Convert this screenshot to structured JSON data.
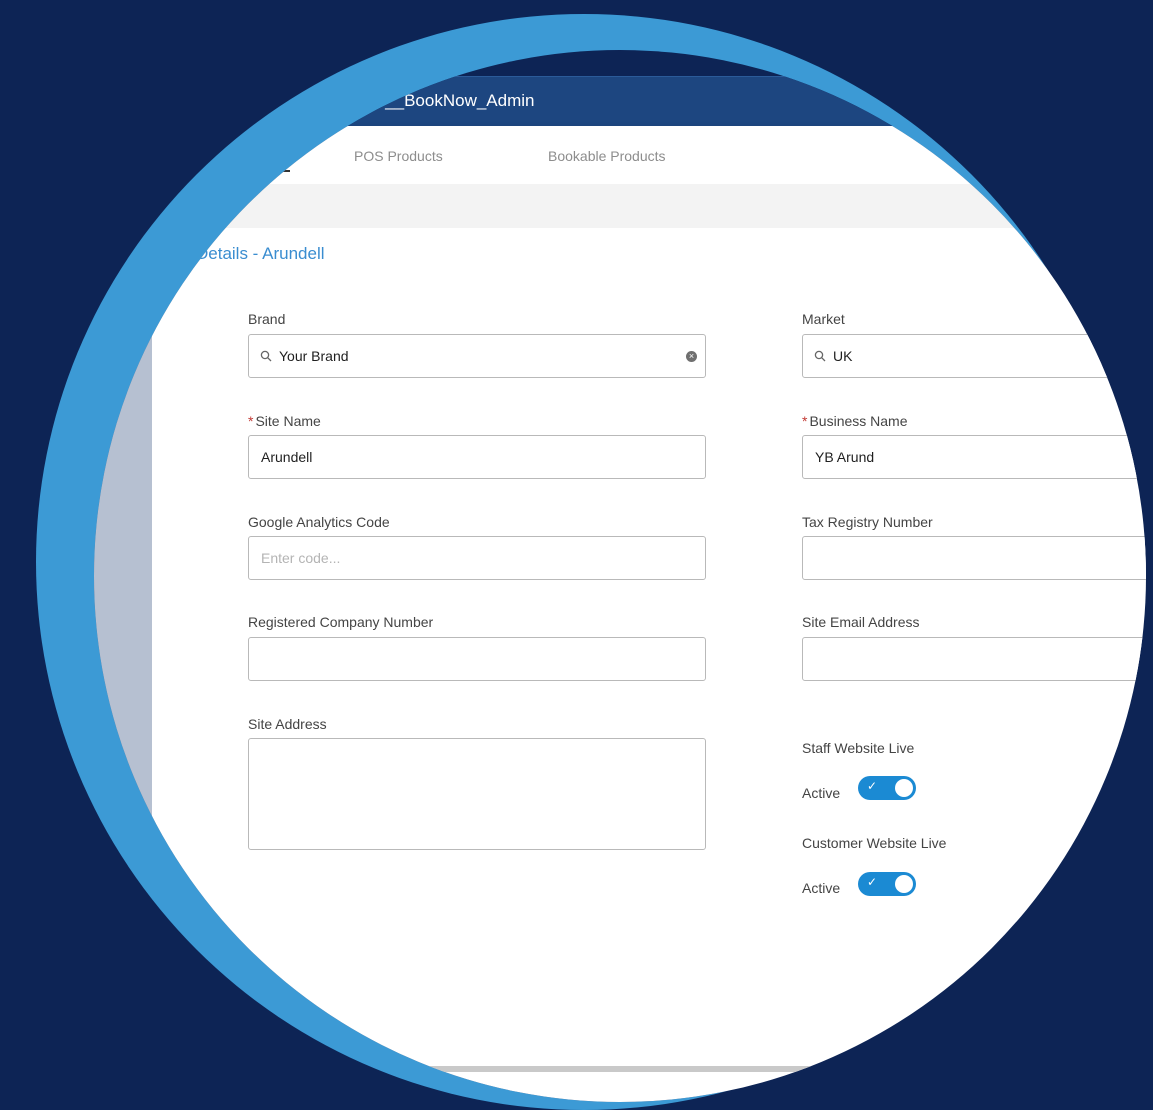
{
  "app": {
    "title": "now__BookNow_Admin"
  },
  "tabs": [
    {
      "label": "POS Products"
    },
    {
      "label": "Bookable Products"
    }
  ],
  "heading": "Details - Arundell",
  "form": {
    "brand": {
      "label": "Brand",
      "value": "Your Brand"
    },
    "market": {
      "label": "Market",
      "value": "UK"
    },
    "site_name": {
      "label": "Site Name",
      "value": "Arundell",
      "required": true
    },
    "business_name": {
      "label": "Business Name",
      "value": "YB Arund",
      "required": true
    },
    "google_analytics": {
      "label": "Google Analytics Code",
      "placeholder": "Enter code..."
    },
    "tax_registry": {
      "label": "Tax Registry Number"
    },
    "company_number": {
      "label": "Registered Company Number"
    },
    "site_email": {
      "label": "Site Email Address"
    },
    "site_address": {
      "label": "Site Address"
    },
    "staff_website": {
      "label": "Staff Website Live",
      "state_label": "Active",
      "on": true
    },
    "customer_website": {
      "label": "Customer Website Live",
      "state_label": "Active",
      "on": true
    },
    "required_mark": "*"
  },
  "colors": {
    "background": "#0d2455",
    "lens_ring": "#3c9ad5",
    "accent": "#1b8ad3",
    "heading": "#3a8dd0"
  }
}
